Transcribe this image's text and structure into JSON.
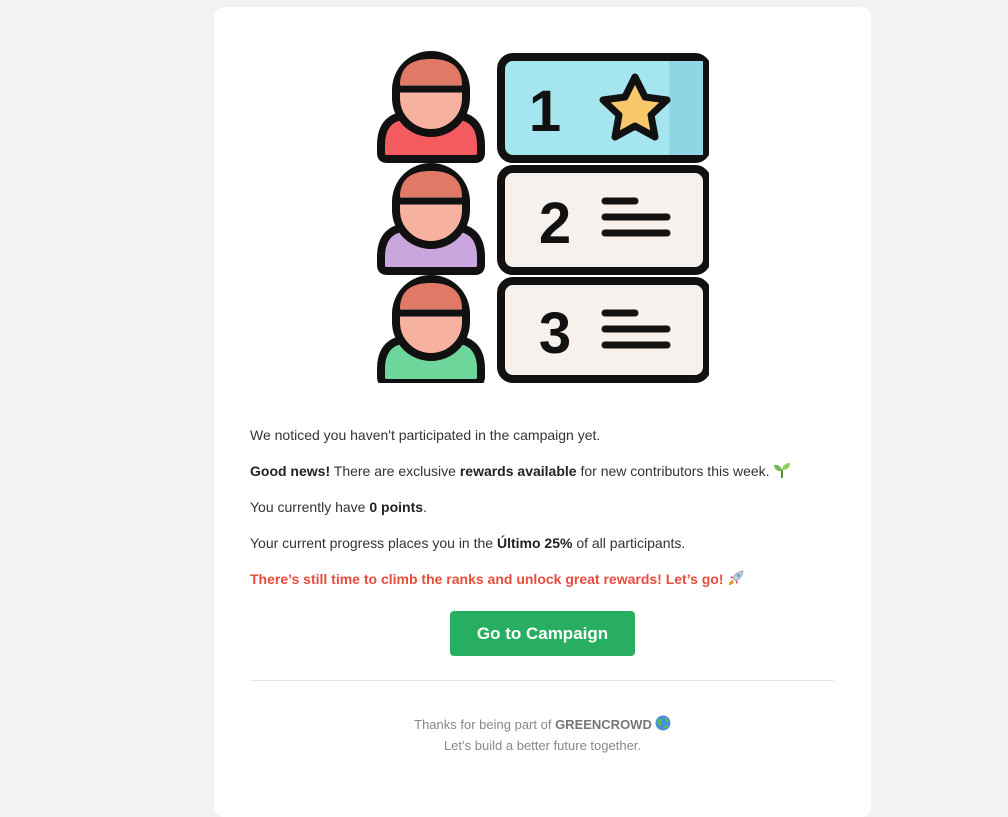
{
  "hero": {
    "ranks": [
      "1",
      "2",
      "3"
    ],
    "avatar_colors": [
      "#f35b5f",
      "#c9a6dd",
      "#6ed69a"
    ],
    "card_colors": [
      "#a4e5f0",
      "#f6f1ec",
      "#f6f1ec"
    ]
  },
  "message": {
    "line1": "We noticed you haven't participated in the campaign yet.",
    "line2_bold1": "Good news!",
    "line2_text1": " There are exclusive ",
    "line2_bold2": "rewards available",
    "line2_text2": " for new contributors this week.",
    "line2_emoji": "seedling-icon",
    "line3_text1": "You currently have ",
    "line3_bold": "0 points",
    "line3_text2": ".",
    "line4_text1": "Your current progress places you in the ",
    "line4_bold": "Último 25%",
    "line4_text2": " of all participants.",
    "cta_text": "There’s still time to climb the ranks and unlock great rewards! Let’s go!",
    "cta_emoji": "rocket-icon"
  },
  "button": {
    "label": "Go to Campaign",
    "color": "#27ae60"
  },
  "footer": {
    "text1": "Thanks for being part of ",
    "brand": "GREENCROWD",
    "line2": "Let’s build a better future together."
  },
  "colors": {
    "alert": "#e74c3c",
    "background": "#f2f2f2"
  }
}
